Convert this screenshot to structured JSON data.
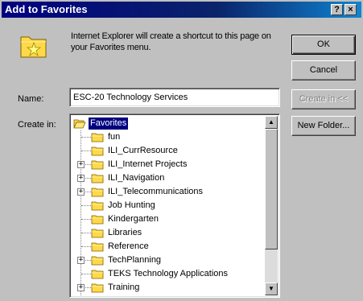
{
  "window": {
    "title": "Add to Favorites",
    "help_button": "?",
    "close_button": "×"
  },
  "description": "Internet Explorer will create a shortcut to this page on your Favorites menu.",
  "buttons": {
    "ok": "OK",
    "cancel": "Cancel",
    "create_in": "Create in <<",
    "new_folder": "New Folder..."
  },
  "name_field": {
    "label": "Name:",
    "value": "ESC-20 Technology Services"
  },
  "create_in_label": "Create in:",
  "tree": {
    "root": "Favorites",
    "items": [
      {
        "label": "fun",
        "expandable": false
      },
      {
        "label": "ILI_CurrResource",
        "expandable": false
      },
      {
        "label": "ILI_Internet Projects",
        "expandable": true
      },
      {
        "label": "ILI_Navigation",
        "expandable": true
      },
      {
        "label": "ILI_Telecommunications",
        "expandable": true
      },
      {
        "label": "Job Hunting",
        "expandable": false
      },
      {
        "label": "Kindergarten",
        "expandable": false
      },
      {
        "label": "Libraries",
        "expandable": false
      },
      {
        "label": "Reference",
        "expandable": false
      },
      {
        "label": "TechPlanning",
        "expandable": true
      },
      {
        "label": "TEKS Technology Applications",
        "expandable": false
      },
      {
        "label": "Training",
        "expandable": true
      }
    ]
  },
  "icons": {
    "favorites": "favorites-star-folder-icon",
    "folder": "folder-icon",
    "open_folder": "open-folder-icon",
    "scroll_up": "scroll-up-arrow-icon",
    "scroll_down": "scroll-down-arrow-icon"
  },
  "colors": {
    "title_bar": "#000080",
    "selection": "#000080",
    "folder": "#ffd94a",
    "dialog_face": "#c0c0c0"
  }
}
